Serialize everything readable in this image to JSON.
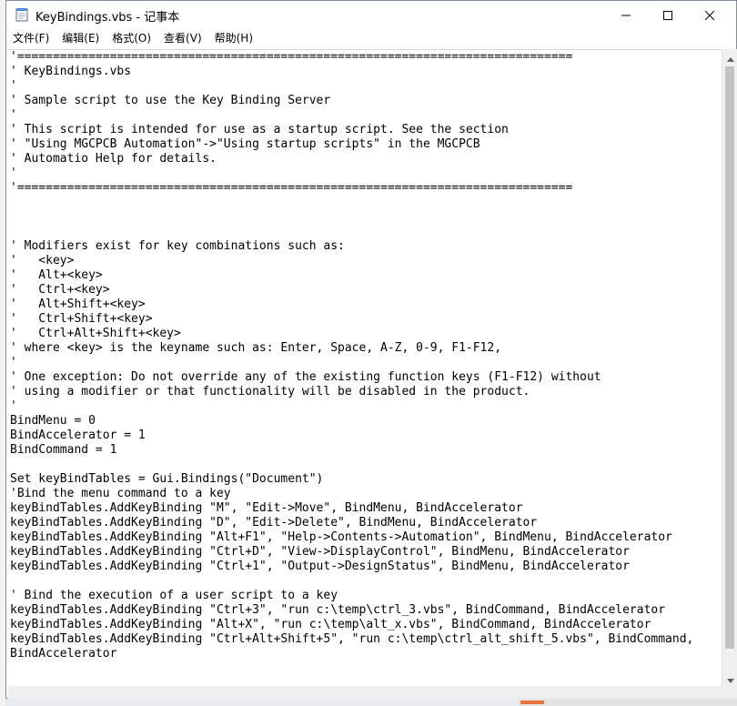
{
  "window": {
    "title": "KeyBindings.vbs - 记事本"
  },
  "menu": {
    "items": [
      "文件(F)",
      "编辑(E)",
      "格式(O)",
      "查看(V)",
      "帮助(H)"
    ]
  },
  "icons": {
    "app": "notepad-icon",
    "minimize": "minimize-icon",
    "maximize": "maximize-icon",
    "close": "close-icon",
    "scroll_up": "scroll-up-arrow-icon",
    "scroll_down": "scroll-down-arrow-icon"
  },
  "colors": {
    "text": "#000000",
    "background": "#ffffff",
    "scrollbar_thumb": "#c2c2c2"
  },
  "editor": {
    "lines": [
      "'==============================================================================",
      "' KeyBindings.vbs",
      "'",
      "' Sample script to use the Key Binding Server",
      "'",
      "' This script is intended for use as a startup script. See the section",
      "' \"Using MGCPCB Automation\"->\"Using startup scripts\" in the MGCPCB",
      "' Automatio Help for details.",
      "'",
      "'==============================================================================",
      "",
      "",
      "",
      "' Modifiers exist for key combinations such as:",
      "'   <key>",
      "'   Alt+<key>",
      "'   Ctrl+<key>",
      "'   Alt+Shift+<key>",
      "'   Ctrl+Shift+<key>",
      "'   Ctrl+Alt+Shift+<key>",
      "' where <key> is the keyname such as: Enter, Space, A-Z, 0-9, F1-F12,",
      "'",
      "' One exception: Do not override any of the existing function keys (F1-F12) without",
      "' using a modifier or that functionality will be disabled in the product.",
      "'",
      "BindMenu = 0",
      "BindAccelerator = 1",
      "BindCommand = 1",
      "",
      "Set keyBindTables = Gui.Bindings(\"Document\")",
      "'Bind the menu command to a key",
      "keyBindTables.AddKeyBinding \"M\", \"Edit->Move\", BindMenu, BindAccelerator",
      "keyBindTables.AddKeyBinding \"D\", \"Edit->Delete\", BindMenu, BindAccelerator",
      "keyBindTables.AddKeyBinding \"Alt+F1\", \"Help->Contents->Automation\", BindMenu, BindAccelerator",
      "keyBindTables.AddKeyBinding \"Ctrl+D\", \"View->DisplayControl\", BindMenu, BindAccelerator",
      "keyBindTables.AddKeyBinding \"Ctrl+1\", \"Output->DesignStatus\", BindMenu, BindAccelerator",
      "",
      "' Bind the execution of a user script to a key",
      "keyBindTables.AddKeyBinding \"Ctrl+3\", \"run c:\\temp\\ctrl_3.vbs\", BindCommand, BindAccelerator",
      "keyBindTables.AddKeyBinding \"Alt+X\", \"run c:\\temp\\alt_x.vbs\", BindCommand, BindAccelerator",
      "keyBindTables.AddKeyBinding \"Ctrl+Alt+Shift+5\", \"run c:\\temp\\ctrl_alt_shift_5.vbs\", BindCommand,",
      "BindAccelerator"
    ]
  }
}
